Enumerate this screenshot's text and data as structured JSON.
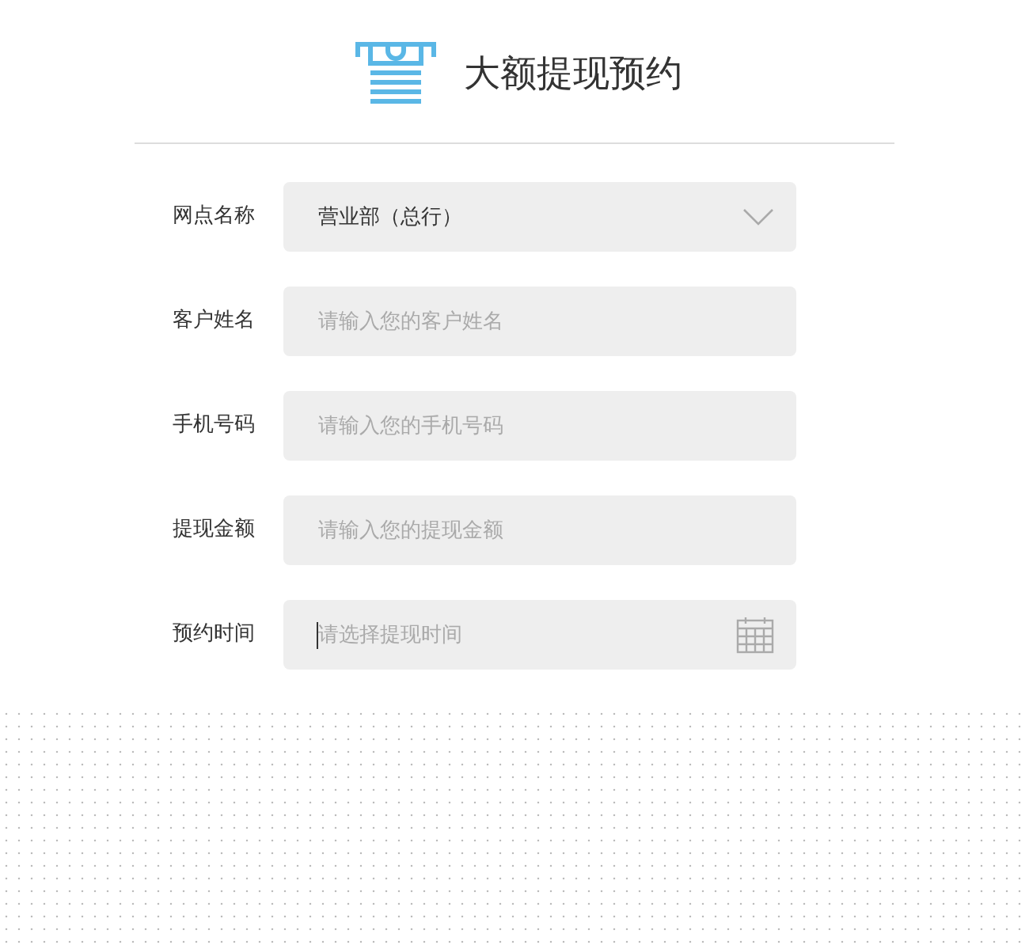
{
  "header": {
    "title": "大额提现预约"
  },
  "fields": [
    {
      "kind": "select",
      "label": "网点名称",
      "value": "营业部（总行）"
    },
    {
      "kind": "text",
      "label": "客户姓名",
      "placeholder": "请输入您的客户姓名"
    },
    {
      "kind": "text",
      "label": "手机号码",
      "placeholder": "请输入您的手机号码"
    },
    {
      "kind": "text",
      "label": "提现金额",
      "placeholder": "请输入您的提现金额"
    },
    {
      "kind": "date",
      "label": "预约时间",
      "placeholder": "请选择提现时间",
      "focused": true
    }
  ]
}
